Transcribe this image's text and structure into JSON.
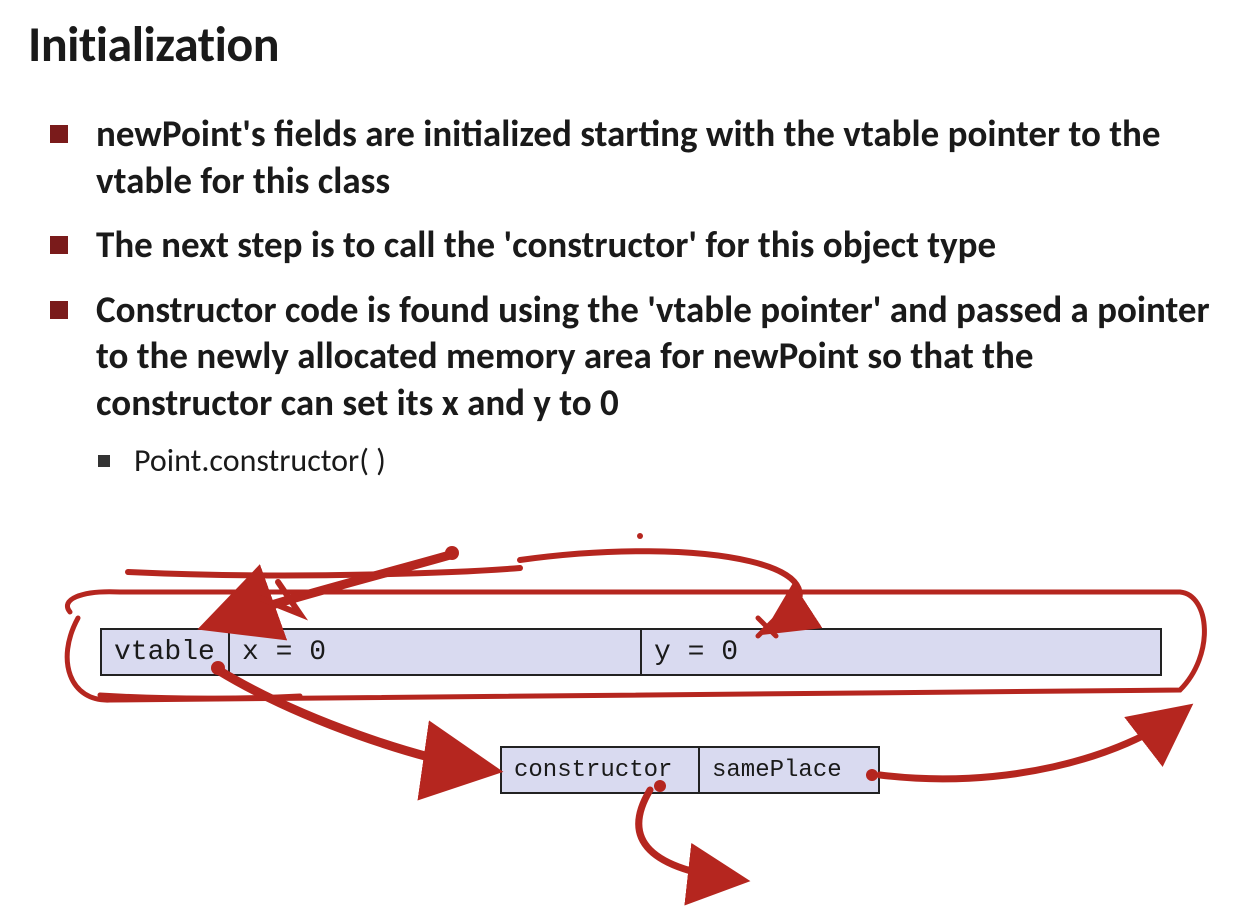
{
  "title": "Initialization",
  "bullets": [
    "newPoint's fields are initialized starting with the vtable pointer to the vtable for this class",
    "The next step is to call the 'constructor' for this object type",
    "Constructor code is found using the 'vtable pointer' and passed a pointer to the newly allocated memory area for newPoint so that the constructor can set its x and y to 0"
  ],
  "sub_bullet": "Point.constructor(       )",
  "memory": {
    "object": {
      "vtable": "vtable",
      "x": "x = 0",
      "y": "y = 0"
    },
    "vtable_row": {
      "constructor": "constructor",
      "samePlace": "samePlace"
    }
  },
  "ink_color": "#b5261f"
}
